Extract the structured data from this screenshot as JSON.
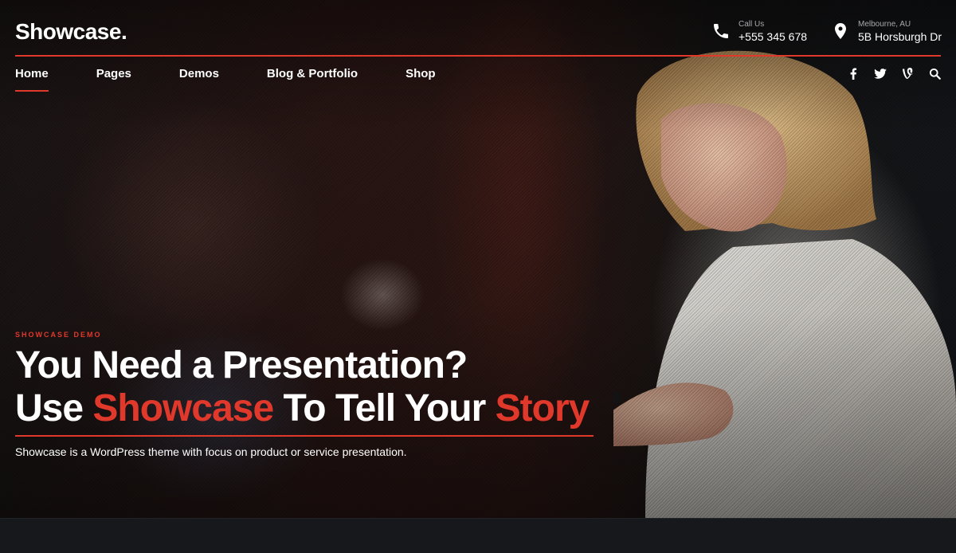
{
  "brand": {
    "logo_text": "Showcase."
  },
  "header": {
    "phone": {
      "label": "Call Us",
      "value": "+555 345 678",
      "icon": "phone-icon"
    },
    "location": {
      "label": "Melbourne, AU",
      "value": "5B Horsburgh Dr",
      "icon": "map-pin-icon"
    }
  },
  "nav": {
    "items": [
      {
        "label": "Home",
        "active": true
      },
      {
        "label": "Pages",
        "active": false
      },
      {
        "label": "Demos",
        "active": false
      },
      {
        "label": "Blog & Portfolio",
        "active": false
      },
      {
        "label": "Shop",
        "active": false
      }
    ],
    "social": [
      "facebook-icon",
      "twitter-icon",
      "vine-icon",
      "search-icon"
    ]
  },
  "hero": {
    "eyebrow": "SHOWCASE DEMO",
    "line1": "You Need a Presentation?",
    "line2_a": "Use ",
    "line2_b": "Showcase",
    "line2_c": " To Tell Your ",
    "line2_d": "Story",
    "subtitle": "Showcase is a WordPress theme with focus on product or service presentation."
  },
  "colors": {
    "accent": "#e0392b",
    "background": "#15161b"
  }
}
